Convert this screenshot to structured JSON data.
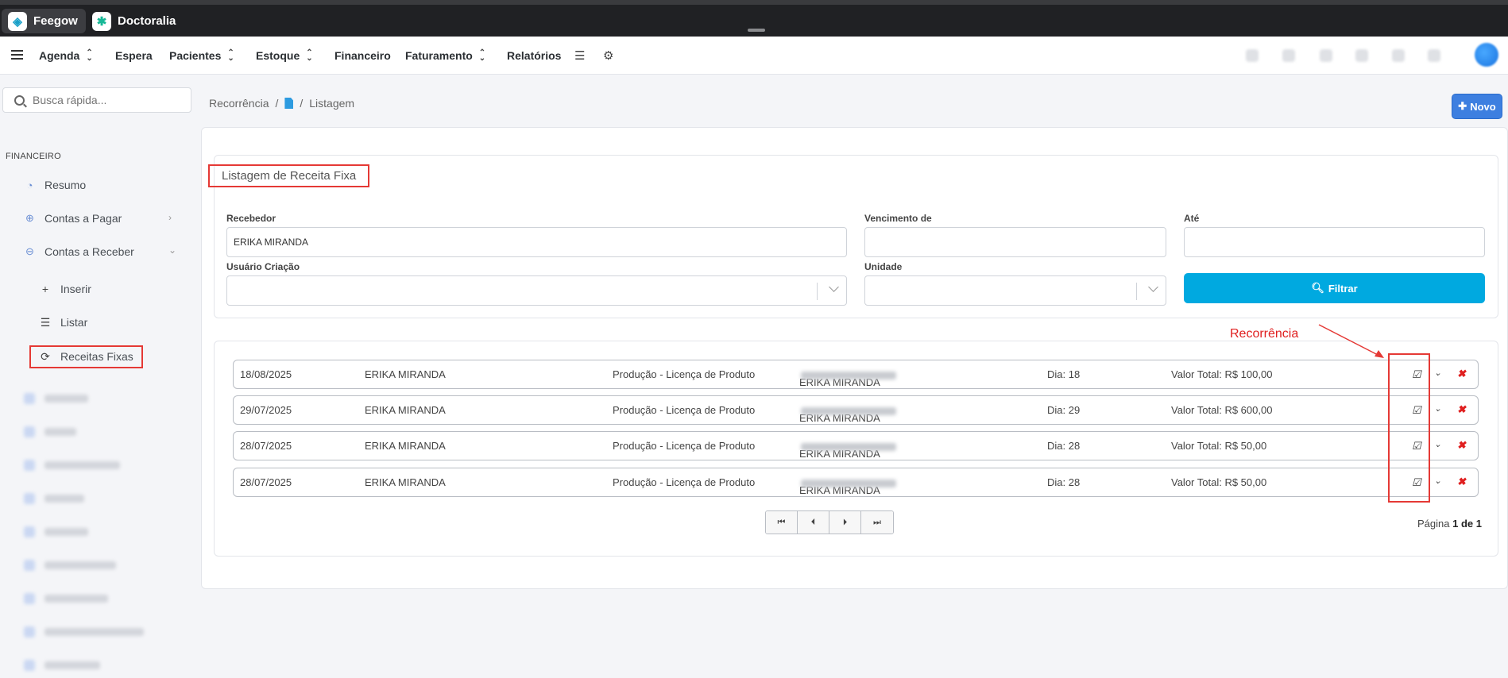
{
  "apps": [
    {
      "label": "Feegow",
      "active": true
    },
    {
      "label": "Doctoralia",
      "active": false
    }
  ],
  "nav": {
    "items": [
      {
        "label": "Agenda",
        "has_sort": true
      },
      {
        "label": "Espera",
        "has_sort": false
      },
      {
        "label": "Pacientes",
        "has_sort": true
      },
      {
        "label": "Estoque",
        "has_sort": true
      },
      {
        "label": "Financeiro",
        "has_sort": false
      },
      {
        "label": "Faturamento",
        "has_sort": true
      },
      {
        "label": "Relatórios",
        "has_sort": false
      }
    ],
    "icons": [
      "database-icon",
      "gear-icon"
    ]
  },
  "sidebar": {
    "search_placeholder": "Busca rápida...",
    "section": "FINANCEIRO",
    "items": [
      {
        "label": "Resumo",
        "icon": "chart-pie-icon"
      },
      {
        "label": "Contas a Pagar",
        "icon": "arrow-up-circle-icon"
      },
      {
        "label": "Contas a Receber",
        "icon": "arrow-down-circle-icon"
      }
    ],
    "subitems": [
      {
        "label": "Inserir",
        "icon": "plus-icon"
      },
      {
        "label": "Listar",
        "icon": "list-icon"
      },
      {
        "label": "Receitas Fixas",
        "icon": "refresh-icon",
        "active": true
      }
    ]
  },
  "breadcrumb": {
    "first": "Recorrência",
    "sep": "/",
    "last": "Listagem"
  },
  "novo_button": "Novo",
  "card": {
    "title": "Listagem de Receita Fixa"
  },
  "filters": {
    "recebedor_label": "Recebedor",
    "recebedor_value": "ERIKA MIRANDA",
    "vencimento_label": "Vencimento de",
    "vencimento_value": "",
    "ate_label": "Até",
    "ate_value": "",
    "usuario_label": "Usuário Criação",
    "unidade_label": "Unidade",
    "filter_button": "Filtrar"
  },
  "annotation": "Recorrência",
  "rows": [
    {
      "date": "18/08/2025",
      "name": "ERIKA MIRANDA",
      "product": "Produção - Licença de Produto",
      "payer": "ERIKA MIRANDA",
      "day": "Dia: 18",
      "total": "Valor Total: R$ 100,00"
    },
    {
      "date": "29/07/2025",
      "name": "ERIKA MIRANDA",
      "product": "Produção - Licença de Produto",
      "payer": "ERIKA MIRANDA",
      "day": "Dia: 29",
      "total": "Valor Total: R$ 600,00"
    },
    {
      "date": "28/07/2025",
      "name": "ERIKA MIRANDA",
      "product": "Produção - Licença de Produto",
      "payer": "ERIKA MIRANDA",
      "day": "Dia: 28",
      "total": "Valor Total: R$ 50,00"
    },
    {
      "date": "28/07/2025",
      "name": "ERIKA MIRANDA",
      "product": "Produção - Licença de Produto",
      "payer": "ERIKA MIRANDA",
      "day": "Dia: 28",
      "total": "Valor Total: R$ 50,00"
    }
  ],
  "pagination": {
    "prefix": "Página",
    "current": "1 de 1"
  },
  "colors": {
    "accent": "#00a9e0",
    "primary": "#3d7fe0",
    "annotation": "#e53935"
  }
}
